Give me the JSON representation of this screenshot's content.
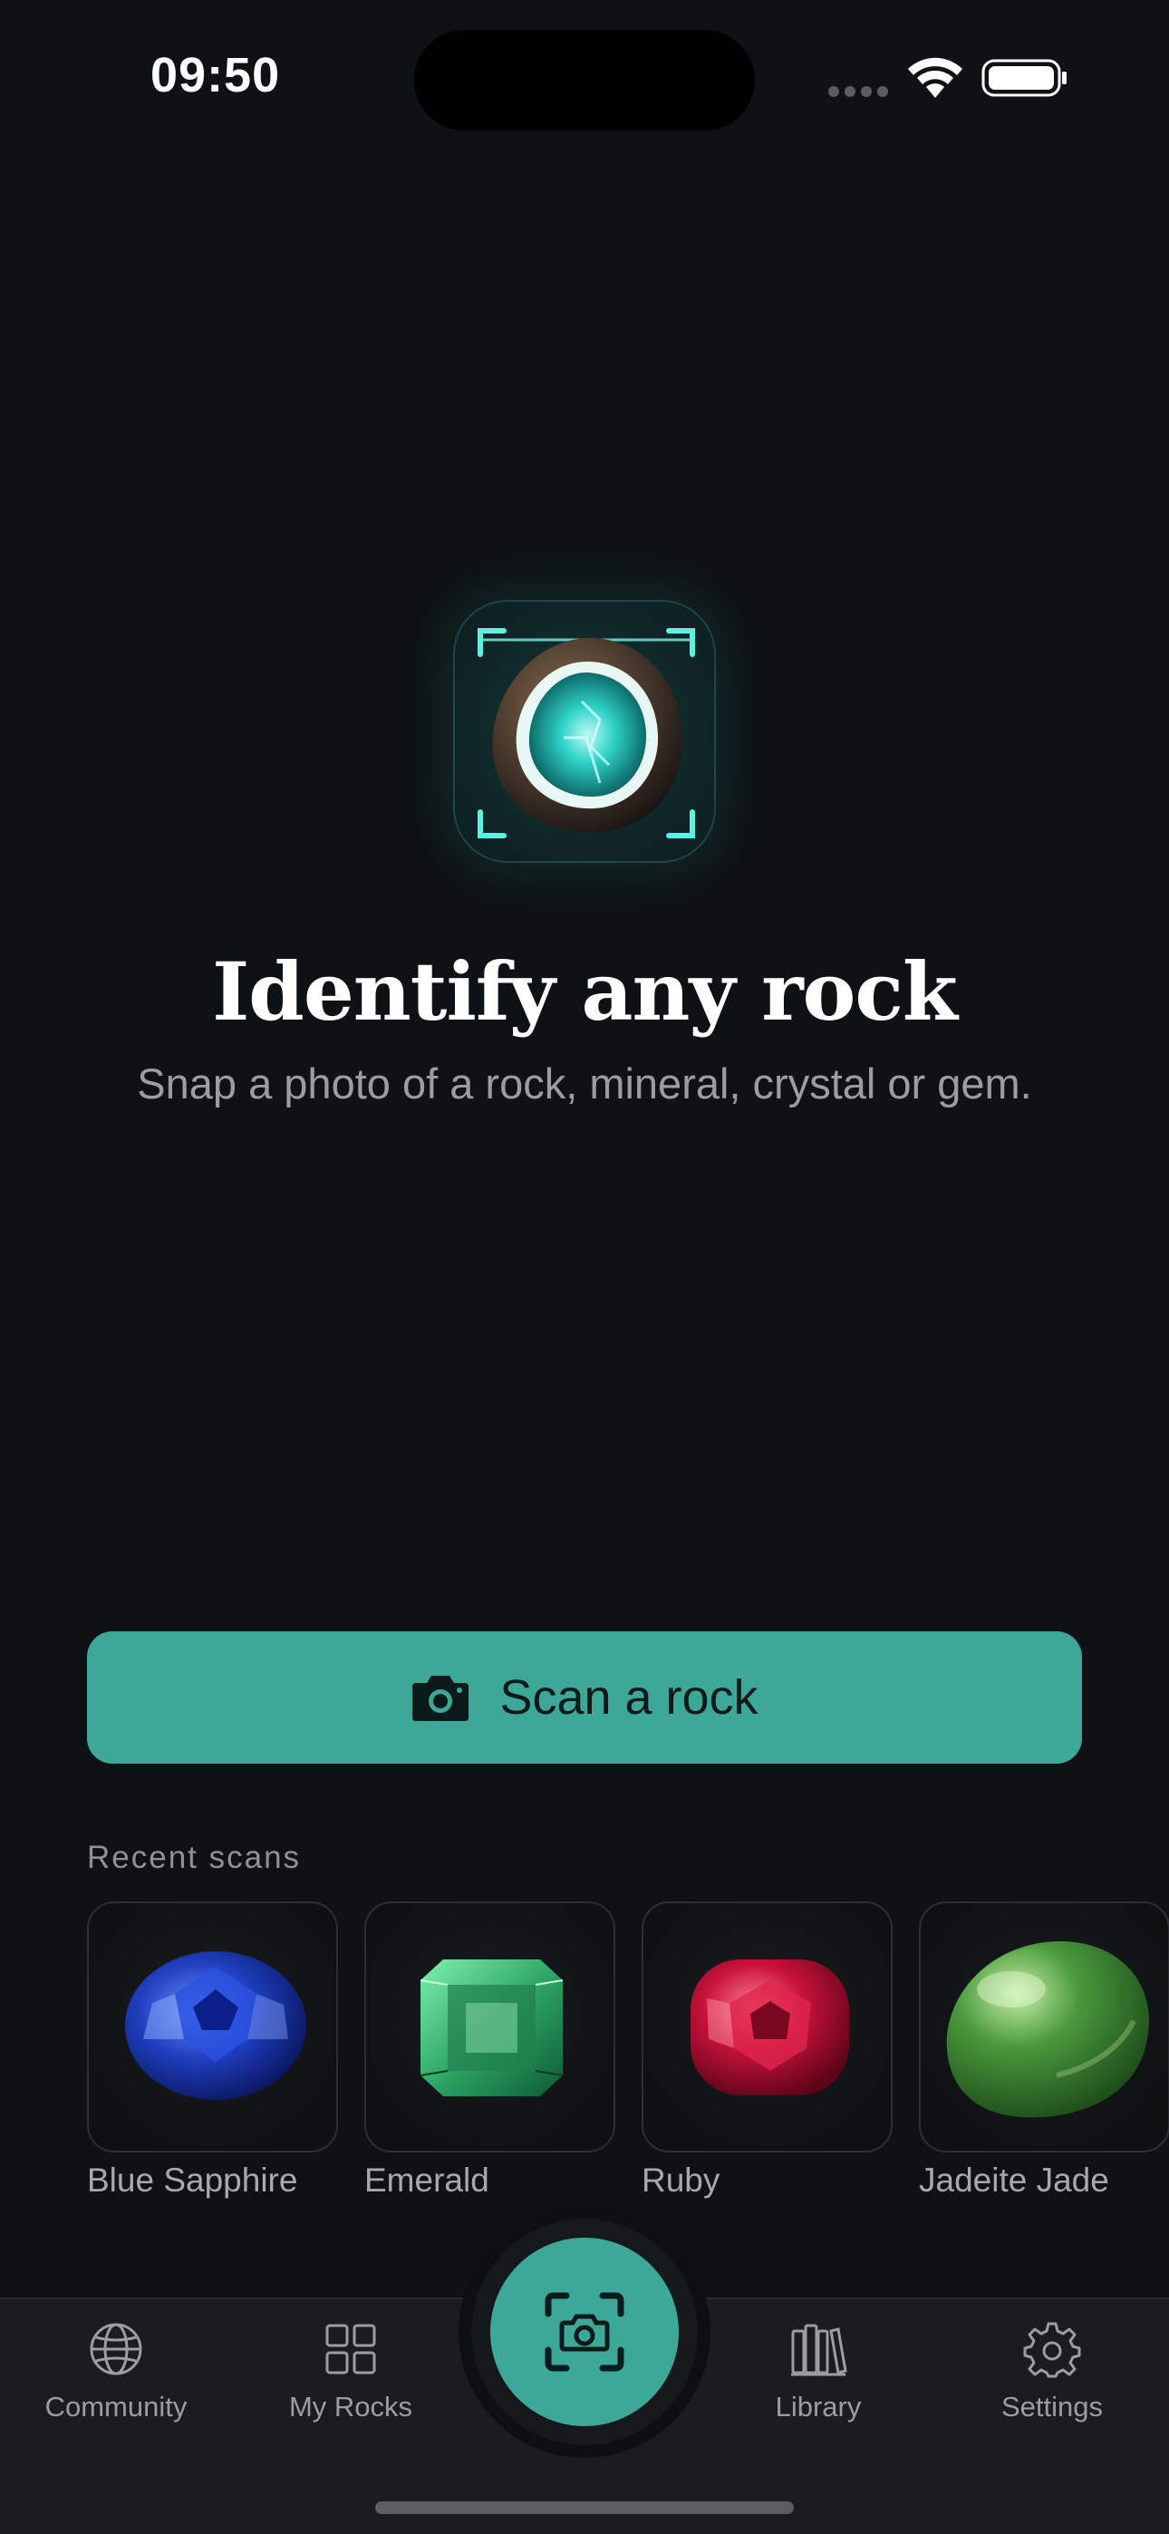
{
  "status_bar": {
    "time": "09:50"
  },
  "hero": {
    "title": "Identify any rock",
    "subtitle": "Snap a photo of a rock, mineral, crystal or gem.",
    "icon": "geode-scan-icon"
  },
  "scan_button": {
    "label": "Scan a rock",
    "icon": "camera-icon"
  },
  "recent": {
    "heading": "Recent scans",
    "items": [
      {
        "name": "Blue Sapphire",
        "color": "#1f3fbf"
      },
      {
        "name": "Emerald",
        "color": "#2fa766"
      },
      {
        "name": "Ruby",
        "color": "#c8123a"
      },
      {
        "name": "Jadeite Jade",
        "color": "#4a9a3c"
      }
    ]
  },
  "tab_bar": {
    "tabs": [
      {
        "label": "Community",
        "icon": "globe-icon"
      },
      {
        "label": "My Rocks",
        "icon": "grid-icon"
      },
      {
        "label": "",
        "icon": "camera-scan-icon"
      },
      {
        "label": "Library",
        "icon": "books-icon"
      },
      {
        "label": "Settings",
        "icon": "gear-icon"
      }
    ]
  },
  "colors": {
    "accent": "#3ea898",
    "background": "#0f1214",
    "tab_bar": "#1a1d20"
  }
}
